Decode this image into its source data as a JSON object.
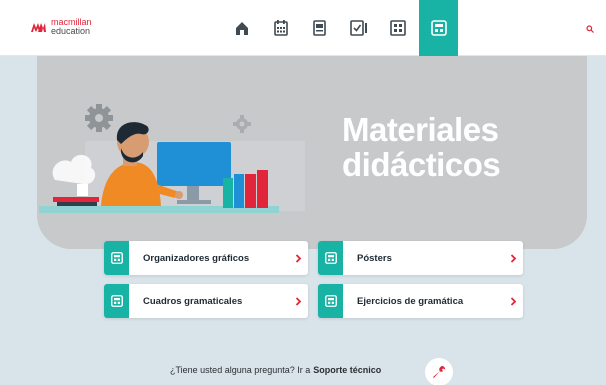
{
  "brand": {
    "line1": "macmillan",
    "line2": "education"
  },
  "nav": {
    "items": [
      {
        "icon": "home-icon"
      },
      {
        "icon": "calendar-icon"
      },
      {
        "icon": "document-icon"
      },
      {
        "icon": "checklist-icon"
      },
      {
        "icon": "grid-icon"
      },
      {
        "icon": "materials-icon",
        "active": true
      }
    ]
  },
  "hero": {
    "title_line1": "Materiales",
    "title_line2": "didácticos"
  },
  "cards": [
    {
      "label": "Organizadores gráficos"
    },
    {
      "label": "Pósters"
    },
    {
      "label": "Cuadros gramaticales"
    },
    {
      "label": "Ejercicios de gramática"
    }
  ],
  "footer": {
    "question": "¿Tiene usted alguna pregunta? Ir a",
    "link": "Soporte técnico"
  },
  "colors": {
    "accent": "#18b3a4",
    "brand_red": "#e1263c",
    "arrow_red": "#e1263c",
    "hero_bg": "#c7c9cb",
    "page_bg": "#d9e4ea"
  }
}
